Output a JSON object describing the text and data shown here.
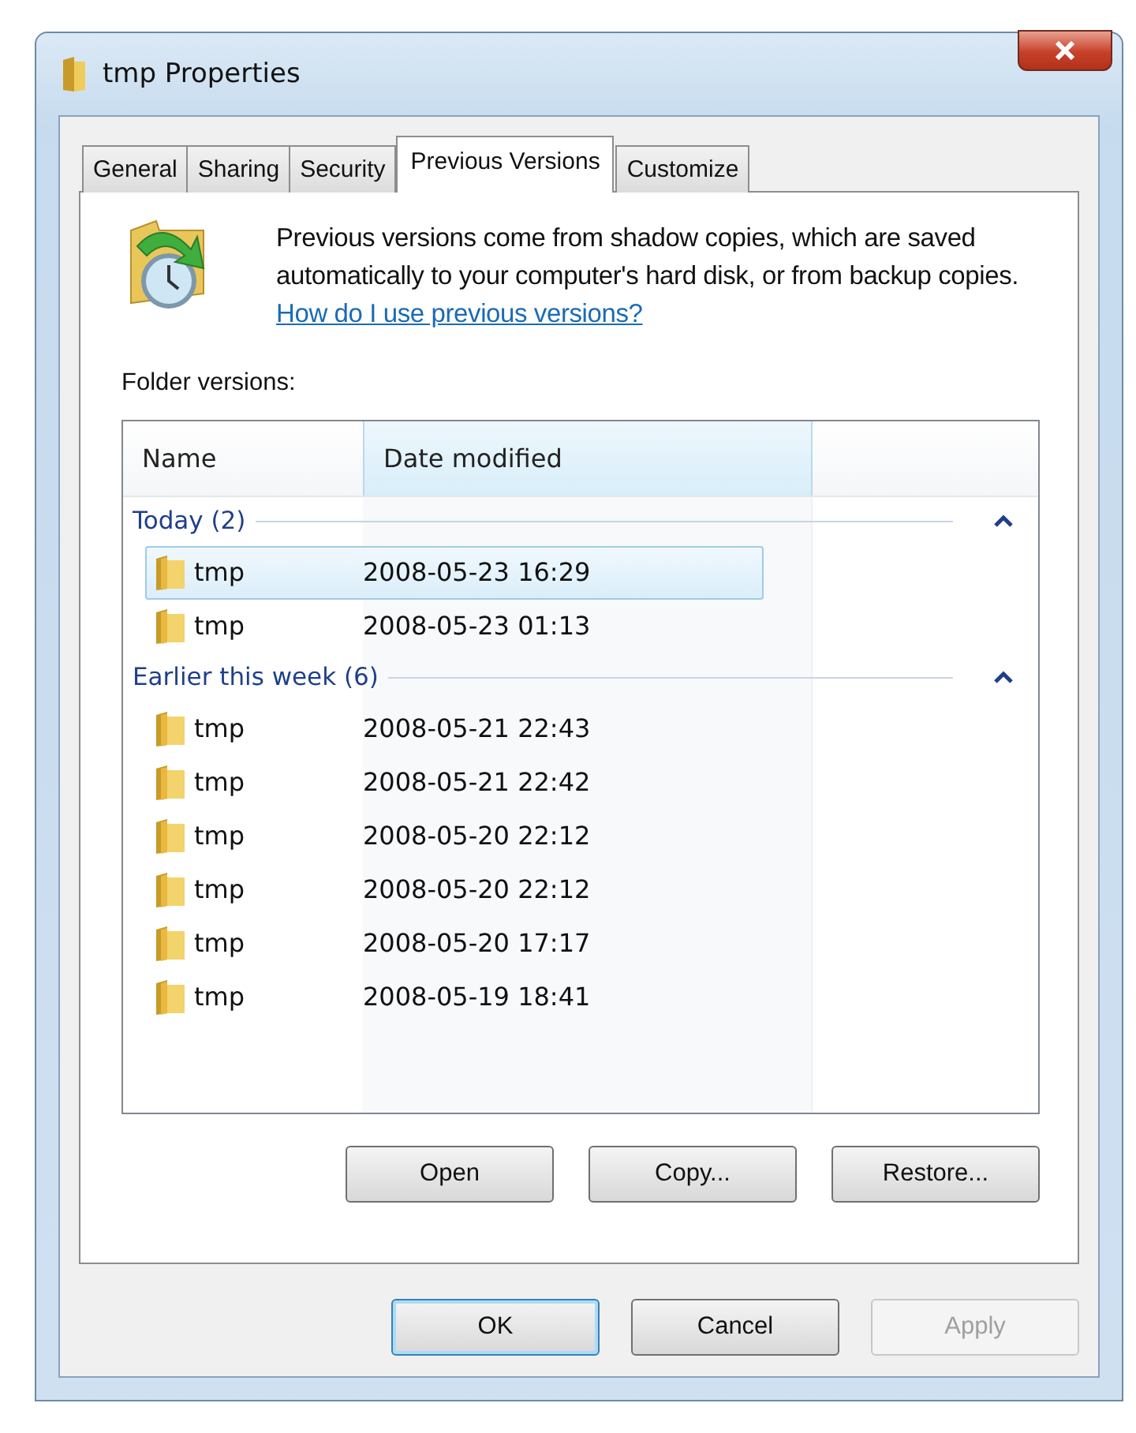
{
  "window": {
    "title": "tmp Properties"
  },
  "tabs": [
    {
      "label": "General",
      "selected": false
    },
    {
      "label": "Sharing",
      "selected": false
    },
    {
      "label": "Security",
      "selected": false
    },
    {
      "label": "Previous Versions",
      "selected": true
    },
    {
      "label": "Customize",
      "selected": false
    }
  ],
  "description": {
    "text": "Previous versions come from shadow copies, which are saved automatically to your computer's hard disk, or from backup copies.",
    "link": "How do I use previous versions?"
  },
  "list_label": "Folder versions:",
  "columns": [
    "Name",
    "Date modified"
  ],
  "groups": [
    {
      "title": "Today (2)",
      "expanded": true,
      "items": [
        {
          "name": "tmp",
          "date": "2008-05-23 16:29",
          "selected": true
        },
        {
          "name": "tmp",
          "date": "2008-05-23 01:13",
          "selected": false
        }
      ]
    },
    {
      "title": "Earlier this week (6)",
      "expanded": true,
      "items": [
        {
          "name": "tmp",
          "date": "2008-05-21 22:43",
          "selected": false
        },
        {
          "name": "tmp",
          "date": "2008-05-21 22:42",
          "selected": false
        },
        {
          "name": "tmp",
          "date": "2008-05-20 22:12",
          "selected": false
        },
        {
          "name": "tmp",
          "date": "2008-05-20 22:12",
          "selected": false
        },
        {
          "name": "tmp",
          "date": "2008-05-20 17:17",
          "selected": false
        },
        {
          "name": "tmp",
          "date": "2008-05-19 18:41",
          "selected": false
        }
      ]
    }
  ],
  "actions": [
    "Open",
    "Copy...",
    "Restore..."
  ],
  "buttons": [
    {
      "label": "OK",
      "default": true,
      "disabled": false
    },
    {
      "label": "Cancel",
      "default": false,
      "disabled": false
    },
    {
      "label": "Apply",
      "default": false,
      "disabled": true
    }
  ]
}
